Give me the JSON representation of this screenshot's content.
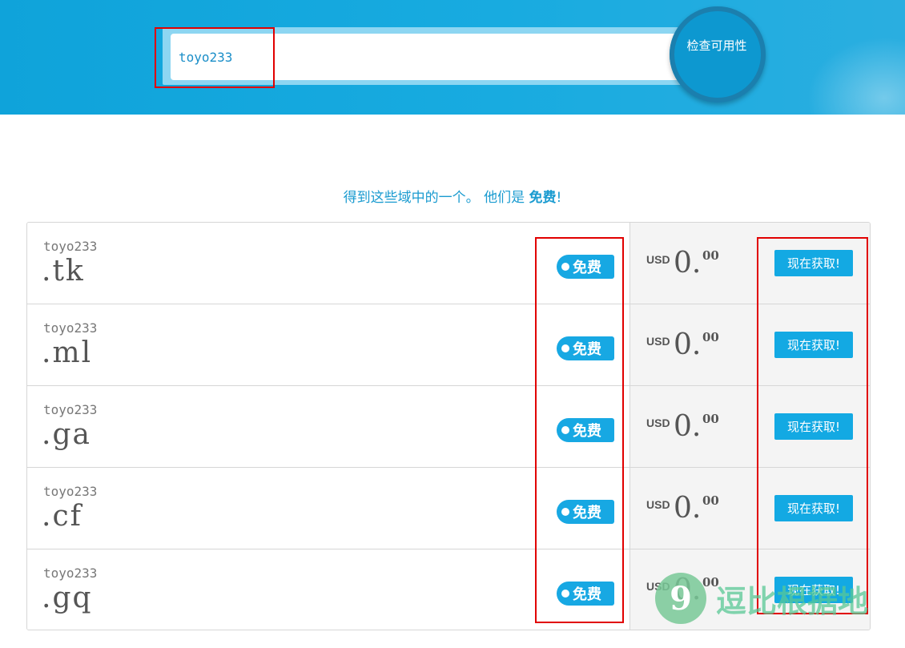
{
  "search": {
    "value": "toyo233",
    "button_label": "检查可用性"
  },
  "tagline": {
    "prefix": "得到这些域中的一个。 他们是",
    "emphasis": "免费",
    "suffix": "!"
  },
  "domains": [
    {
      "name": "toyo233",
      "tld": ".tk",
      "badge": "免费",
      "currency": "USD",
      "price_int": "0.",
      "price_dec": "00",
      "button": "现在获取!"
    },
    {
      "name": "toyo233",
      "tld": ".ml",
      "badge": "免费",
      "currency": "USD",
      "price_int": "0.",
      "price_dec": "00",
      "button": "现在获取!"
    },
    {
      "name": "toyo233",
      "tld": ".ga",
      "badge": "免费",
      "currency": "USD",
      "price_int": "0.",
      "price_dec": "00",
      "button": "现在获取!"
    },
    {
      "name": "toyo233",
      "tld": ".cf",
      "badge": "免费",
      "currency": "USD",
      "price_int": "0.",
      "price_dec": "00",
      "button": "现在获取!"
    },
    {
      "name": "toyo233",
      "tld": ".gq",
      "badge": "免费",
      "currency": "USD",
      "price_int": "0.",
      "price_dec": "00",
      "button": "现在获取!"
    }
  ],
  "watermark": {
    "logo_glyph": "9",
    "text": "逗比根据地"
  },
  "colors": {
    "brand_blue": "#13a9e3",
    "highlight_red": "#e10000"
  }
}
